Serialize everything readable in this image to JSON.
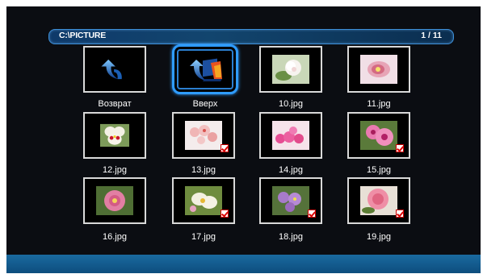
{
  "header": {
    "path": "C:\\PICTURE",
    "page_counter": "1 / 11"
  },
  "items": [
    {
      "label": "Возврат",
      "icon": "return-arrow-icon"
    },
    {
      "label": "Вверх",
      "icon": "up-folder-icon",
      "selected": true
    },
    {
      "label": "10.jpg",
      "checked": false
    },
    {
      "label": "11.jpg",
      "checked": false
    },
    {
      "label": "12.jpg",
      "checked": false
    },
    {
      "label": "13.jpg",
      "checked": true
    },
    {
      "label": "14.jpg",
      "checked": false
    },
    {
      "label": "15.jpg",
      "checked": true
    },
    {
      "label": "16.jpg",
      "checked": false
    },
    {
      "label": "17.jpg",
      "checked": true
    },
    {
      "label": "18.jpg",
      "checked": true
    },
    {
      "label": "19.jpg",
      "checked": true
    }
  ],
  "colors": {
    "accent": "#2f9cff",
    "background": "#0b0d12",
    "check": "#d00000"
  }
}
